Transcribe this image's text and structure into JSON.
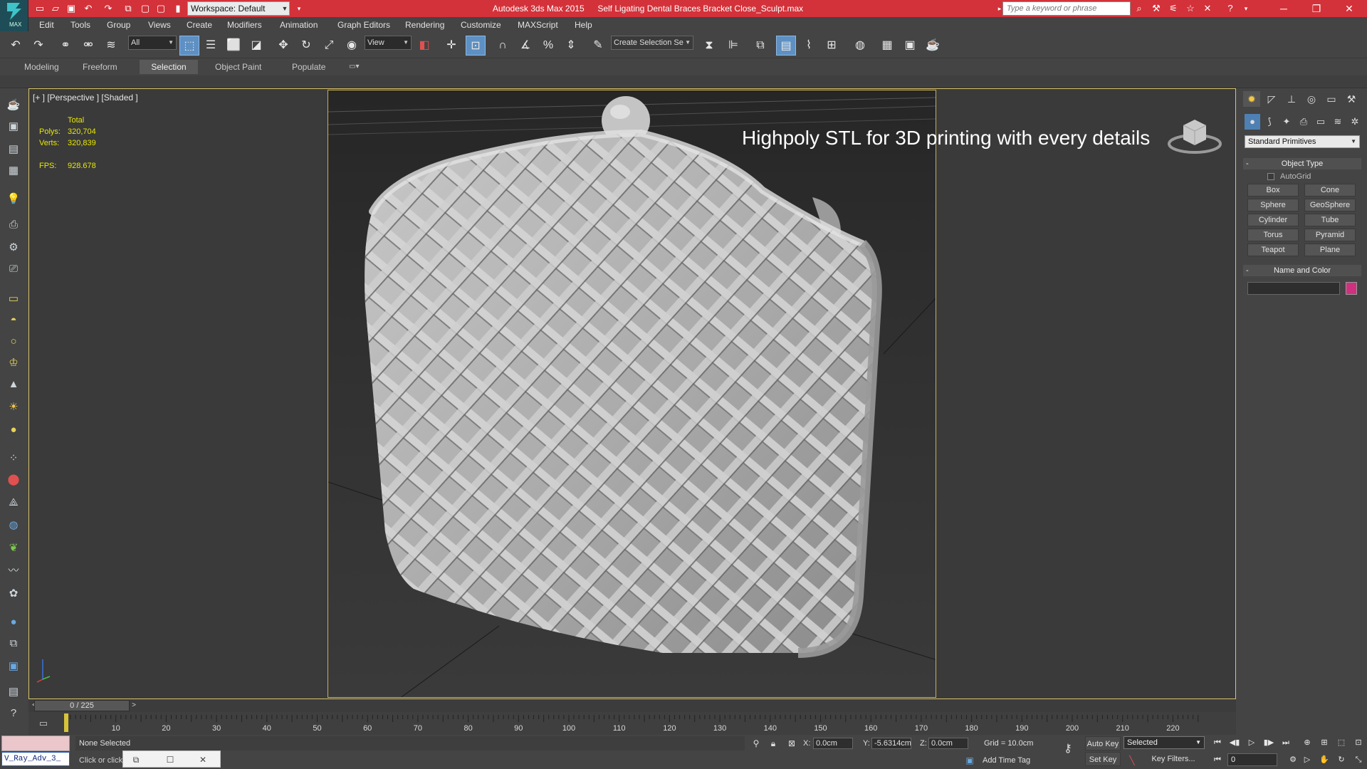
{
  "title_bar": {
    "app_name": "Autodesk 3ds Max  2015",
    "file_name": "Self Ligating Dental Braces Bracket Close_Sculpt.max",
    "workspace": "Workspace: Default",
    "search_placeholder": "Type a keyword or phrase",
    "logo_text": "MAX",
    "colors": {
      "title_bg": "#d3323a"
    }
  },
  "menu": {
    "items": [
      "Edit",
      "Tools",
      "Group",
      "Views",
      "Create",
      "Modifiers",
      "Animation",
      "Graph Editors",
      "Rendering",
      "Customize",
      "MAXScript",
      "Help"
    ]
  },
  "toolbar": {
    "selection_filter": "All",
    "reference_coord": "View",
    "named_selection_placeholder": "Create Selection Se"
  },
  "ribbon": {
    "tabs": [
      "Modeling",
      "Freeform",
      "Selection",
      "Object Paint",
      "Populate"
    ],
    "active_tab": "Selection"
  },
  "viewport": {
    "label": "[+ ] [Perspective ] [Shaded ]",
    "stats": {
      "total_label": "Total",
      "polys_label": "Polys:",
      "polys_value": "320,704",
      "verts_label": "Verts:",
      "verts_value": "320,839",
      "fps_label": "FPS:",
      "fps_value": "928.678",
      "color": "#e8e800"
    },
    "overlay_text": "Highpoly STL for 3D printing with every details"
  },
  "command_panel": {
    "primitive_category": "Standard Primitives",
    "object_type_title": "Object Type",
    "autogrid_label": "AutoGrid",
    "primitives": [
      "Box",
      "Cone",
      "Sphere",
      "GeoSphere",
      "Cylinder",
      "Tube",
      "Torus",
      "Pyramid",
      "Teapot",
      "Plane"
    ],
    "name_color_title": "Name and Color",
    "object_color": "#d0317e"
  },
  "timeline": {
    "frame_display": "0 / 225",
    "prev_arrow": "<",
    "next_arrow": ">",
    "ticks": [
      "10",
      "20",
      "30",
      "40",
      "50",
      "60",
      "70",
      "80",
      "90",
      "100",
      "110",
      "120",
      "130",
      "140",
      "150",
      "160",
      "170",
      "180",
      "190",
      "200",
      "210",
      "220"
    ]
  },
  "status": {
    "maxscript_value": "V_Ray_Adv_3_",
    "selection_status": "None Selected",
    "prompt": "Click or click",
    "x_label": "X:",
    "x_value": "0.0cm",
    "y_label": "Y:",
    "y_value": "-5.6314cm",
    "z_label": "Z:",
    "z_value": "0.0cm",
    "grid": "Grid = 10.0cm",
    "add_time_tag": "Add Time Tag",
    "auto_key": "Auto Key",
    "set_key": "Set Key",
    "key_mode": "Selected",
    "key_filters": "Key Filters...",
    "current_frame": "0"
  }
}
